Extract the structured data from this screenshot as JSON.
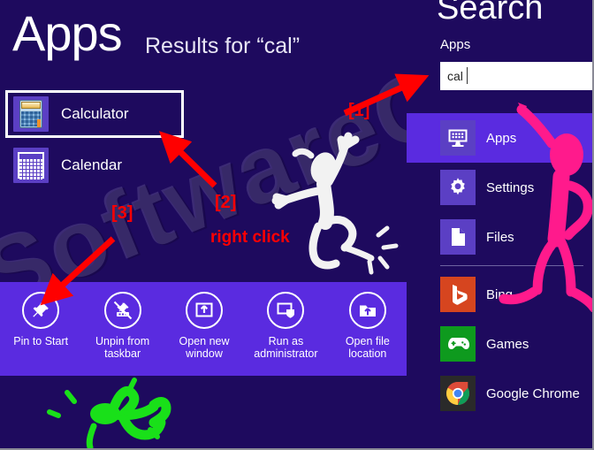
{
  "page": {
    "title": "Apps",
    "results_for": "Results for “cal”",
    "watermark": "SoftwareOK",
    "background_color": "#1e0a5e",
    "accent_color": "#5a2be0",
    "tile_color": "#5b3fc4",
    "annotation_color": "#ff0000"
  },
  "results": {
    "items": [
      {
        "label": "Calculator",
        "icon": "calculator-icon",
        "selected": true
      },
      {
        "label": "Calendar",
        "icon": "calendar-icon",
        "selected": false
      }
    ]
  },
  "app_bar": {
    "commands": [
      {
        "label": "Pin to Start",
        "icon": "pin-icon"
      },
      {
        "label": "Unpin from taskbar",
        "icon": "unpin-taskbar-icon"
      },
      {
        "label": "Open new window",
        "icon": "open-new-window-icon"
      },
      {
        "label": "Run as administrator",
        "icon": "run-as-administrator-icon"
      },
      {
        "label": "Open file location",
        "icon": "open-file-location-icon"
      }
    ]
  },
  "search_charm": {
    "title": "Search",
    "scope_label": "Apps",
    "query": "cal",
    "placeholder": "",
    "items": [
      {
        "label": "Apps",
        "icon": "apps-icon",
        "color": "#5b3fc4",
        "selected": true
      },
      {
        "label": "Settings",
        "icon": "gear-icon",
        "color": "#5b3fc4",
        "selected": false
      },
      {
        "label": "Files",
        "icon": "file-icon",
        "color": "#5b3fc4",
        "selected": false
      },
      {
        "label": "Bing",
        "icon": "bing-icon",
        "color": "#d6451f",
        "selected": false
      },
      {
        "label": "Games",
        "icon": "gamepad-icon",
        "color": "#0e9a1e",
        "selected": false
      },
      {
        "label": "Google Chrome",
        "icon": "chrome-icon",
        "color": "#2a2a2a",
        "selected": false
      }
    ]
  },
  "annotations": {
    "marker_1": "[1]",
    "marker_2": "[2]",
    "marker_3": "[3]",
    "right_click": "right click"
  }
}
